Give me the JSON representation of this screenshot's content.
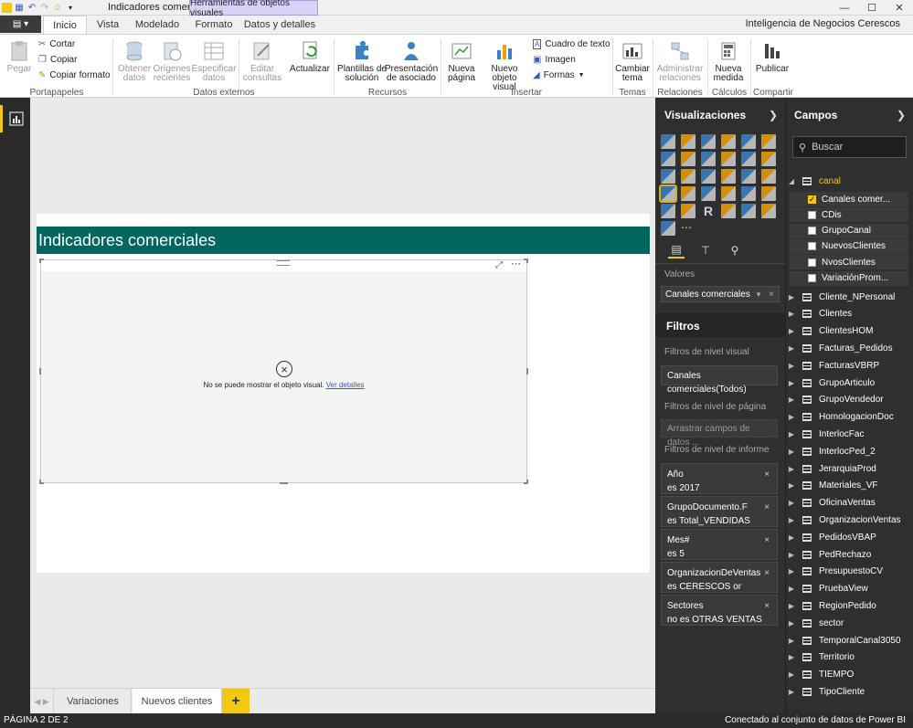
{
  "titlebar": {
    "doc_title": "Indicadores comer...",
    "context_title": "Herramientas de objetos visuales"
  },
  "tabs": {
    "items": [
      {
        "label": "Inicio"
      },
      {
        "label": "Vista"
      },
      {
        "label": "Modelado"
      },
      {
        "label": "Formato"
      },
      {
        "label": "Datos y detalles"
      }
    ],
    "brand": "Inteligencia de Negocios Cerescos"
  },
  "ribbon": {
    "pegar": "Pegar",
    "cortar": "Cortar",
    "copiar": "Copiar",
    "copiar_formato": "Copiar formato",
    "obtener_datos_1": "Obtener",
    "obtener_datos_2": "datos",
    "origenes_1": "Orígenes",
    "origenes_2": "recientes",
    "especificar_1": "Especificar",
    "especificar_2": "datos",
    "editar_1": "Editar",
    "editar_2": "consultas",
    "actualizar": "Actualizar",
    "plantillas_1": "Plantillas de",
    "plantillas_2": "solución",
    "presentacion_1": "Presentación",
    "presentacion_2": "de asociado",
    "nueva_pagina_1": "Nueva",
    "nueva_pagina_2": "página",
    "nuevo_objeto_1": "Nuevo",
    "nuevo_objeto_2": "objeto visual",
    "cuadro_texto": "Cuadro de texto",
    "imagen": "Imagen",
    "formas": "Formas",
    "cambiar_tema_1": "Cambiar",
    "cambiar_tema_2": "tema",
    "administrar_1": "Administrar",
    "administrar_2": "relaciones",
    "nueva_medida_1": "Nueva",
    "nueva_medida_2": "medida",
    "publicar": "Publicar",
    "groups": {
      "portapapeles": "Portapapeles",
      "datos_externos": "Datos externos",
      "recursos": "Recursos",
      "insertar": "Insertar",
      "temas": "Temas",
      "relaciones": "Relaciones",
      "calculos": "Cálculos",
      "compartir": "Compartir"
    }
  },
  "report": {
    "header": "Indicadores comerciales",
    "error_text": "No se puede mostrar el objeto visual.",
    "error_link": "Ver detalles"
  },
  "pages": {
    "items": [
      {
        "label": "Variaciones"
      },
      {
        "label": "Nuevos clientes"
      }
    ],
    "add": "+"
  },
  "status": {
    "left": "PÁGINA 2 DE 2",
    "right": "Conectado al conjunto de datos de Power BI"
  },
  "viz_pane": {
    "title": "Visualizaciones",
    "valores_label": "Valores",
    "valores_value": "Canales comerciales",
    "filtros_title": "Filtros",
    "visual_level": "Filtros de nivel visual",
    "visual_filter": "Canales comerciales(Todos)",
    "page_level": "Filtros de nivel de página",
    "page_drop": "Arrastrar campos de datos ...",
    "report_level": "Filtros de nivel de informe",
    "report_filters": [
      {
        "name": "Año",
        "value": "es 2017"
      },
      {
        "name": "GrupoDocumento.F",
        "value": "es Total_VENDIDAS"
      },
      {
        "name": "Mes#",
        "value": "es 5"
      },
      {
        "name": "OrganizacionDeVentas",
        "value": "es CERESCOS or (Blan..."
      },
      {
        "name": "Sectores",
        "value": "no es OTRAS VENTAS"
      }
    ]
  },
  "fields_pane": {
    "title": "Campos",
    "search_placeholder": "Buscar",
    "expanded_table": "canal",
    "fields": [
      {
        "label": "Canales comer...",
        "checked": true
      },
      {
        "label": "CDis",
        "checked": false
      },
      {
        "label": "GrupoCanal",
        "checked": false
      },
      {
        "label": "NuevosClientes",
        "checked": false
      },
      {
        "label": "NvosClientes",
        "checked": false
      },
      {
        "label": "VariaciónProm...",
        "checked": false
      }
    ],
    "tables": [
      {
        "label": "Cliente_NPersonal"
      },
      {
        "label": "Clientes"
      },
      {
        "label": "ClientesHOM"
      },
      {
        "label": "Facturas_Pedidos"
      },
      {
        "label": "FacturasVBRP"
      },
      {
        "label": "GrupoArticulo"
      },
      {
        "label": "GrupoVendedor"
      },
      {
        "label": "HomologacionDoc"
      },
      {
        "label": "InterlocFac"
      },
      {
        "label": "InterlocPed_2"
      },
      {
        "label": "JerarquiaProd"
      },
      {
        "label": "Materiales_VF"
      },
      {
        "label": "OficinaVentas"
      },
      {
        "label": "OrganizacionVentas"
      },
      {
        "label": "PedidosVBAP"
      },
      {
        "label": "PedRechazo"
      },
      {
        "label": "PresupuestoCV"
      },
      {
        "label": "PruebaView"
      },
      {
        "label": "RegionPedido"
      },
      {
        "label": "sector"
      },
      {
        "label": "TemporalCanal3050"
      },
      {
        "label": "Territorio"
      },
      {
        "label": "TIEMPO"
      },
      {
        "label": "TipoCliente"
      }
    ]
  }
}
